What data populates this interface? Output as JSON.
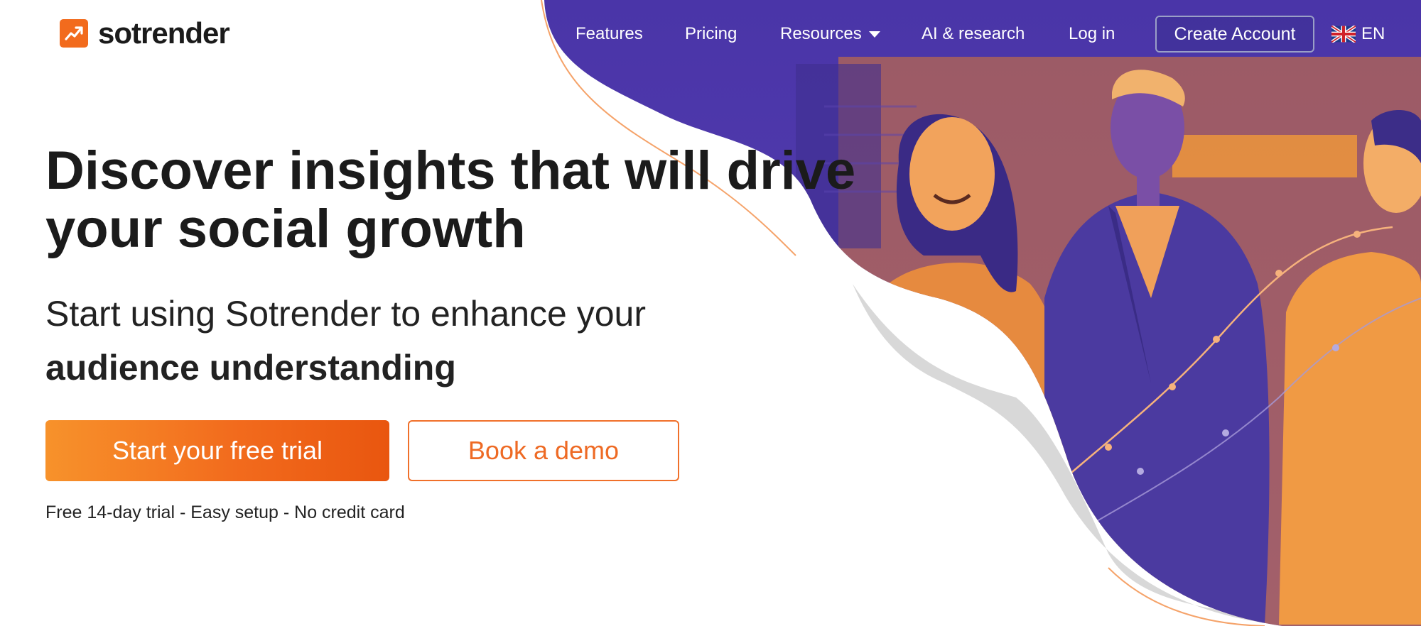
{
  "brand": {
    "name": "sotrender"
  },
  "nav": {
    "features": "Features",
    "pricing": "Pricing",
    "resources": "Resources",
    "ai_research": "AI & research",
    "login": "Log in",
    "create_account": "Create Account",
    "language": "EN"
  },
  "hero": {
    "headline": "Discover insights that will drive your social growth",
    "subhead_light": "Start using Sotrender to enhance your",
    "subhead_bold": "audience understanding",
    "cta_primary": "Start your free trial",
    "cta_secondary": "Book a demo",
    "note": "Free 14-day trial - Easy setup - No credit card"
  },
  "colors": {
    "accent": "#f26b1d",
    "purple": "#4b37a6",
    "text": "#1b1b1b"
  },
  "icons": [
    "trend-up-icon",
    "chevron-down-icon",
    "uk-flag-icon"
  ]
}
